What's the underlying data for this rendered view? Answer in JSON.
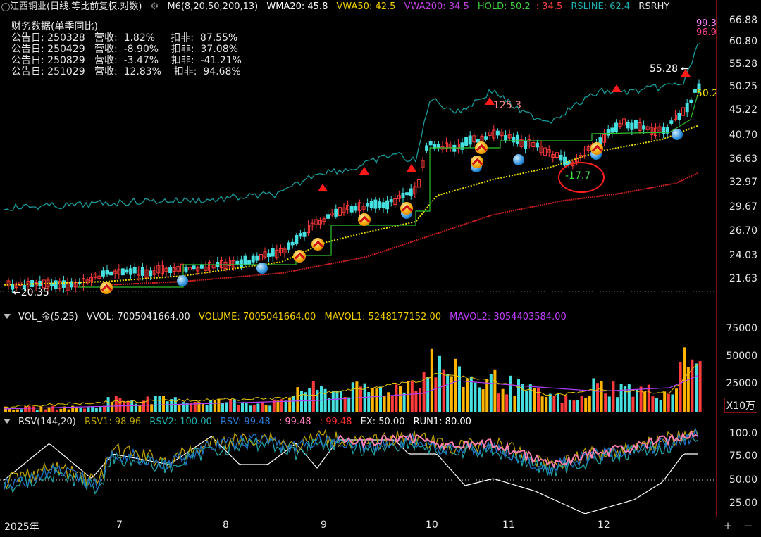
{
  "main_header": {
    "symbol": "江西铜业(日线.等比前复权.对数)",
    "m6": "M6(8,20,50,200,13)",
    "wma20": "WMA20: 45.8",
    "vwa50": "VWA50: 42.5",
    "vwa200": "VWA200: 34.5",
    "hold_label": "HOLD: 50.2",
    "hold_sep": ":",
    "hold_val2": "34.5",
    "rsline": "RSLINE: 62.4",
    "rsrhy": "RSRHY"
  },
  "financials": {
    "title": "财务数据(单季同比)",
    "rows": [
      "公告日: 250328   营收:  1.82%     扣非:  87.55%",
      "公告日: 250429   营收:  -8.90%    扣非:  37.08%",
      "公告日: 250829   营收:  -3.47%    扣非:  -41.21%",
      "公告日: 251029   营收:  12.83%    扣非:  94.68%"
    ]
  },
  "price_annotations": {
    "low": "20.35",
    "high": "55.28",
    "high_arrow": "←",
    "low_arrow": "←",
    "label_125": "125.3",
    "label_neg": "-17.7",
    "hold_right": "50.2",
    "rs_right_1": "99.3",
    "rs_right_2": "96.9"
  },
  "price_axis": [
    "66.88",
    "60.80",
    "55.28",
    "50.25",
    "45.22",
    "40.70",
    "36.63",
    "32.97",
    "29.67",
    "26.70",
    "24.03",
    "21.63"
  ],
  "volume_header": {
    "name": "VOL_金(5,25)",
    "vvol": "VVOL: 7005041664.00",
    "volume": "VOLUME: 7005041664.00",
    "mavol1": "MAVOL1: 5248177152.00",
    "mavol2": "MAVOL2: 3054403584.00"
  },
  "volume_axis": [
    "75000",
    "50000",
    "25000"
  ],
  "volume_unit": "X10万",
  "rsv_header": {
    "name": "RSV(144,20)",
    "rsv1": "RSV1: 98.96",
    "rsv2": "RSV2: 100.00",
    "rsv": "RSV: 99.48",
    "v1": ": 99.48",
    "v2": ": 99.48",
    "ex": "EX: 50.00",
    "run1": "RUN1: 80.00"
  },
  "rsv_axis": [
    "100.0",
    "75.00",
    "50.00",
    "25.00"
  ],
  "months": [
    "2025年",
    "7",
    "8",
    "9",
    "10",
    "11",
    "12"
  ],
  "controls": {
    "plus": "+",
    "minus": "−"
  },
  "colors": {
    "up": "#ff3b3b",
    "down": "#46e0e0",
    "wma": "#f0e000",
    "vwa200": "#d02020",
    "vwa200b": "#b030d0",
    "hold": "#30c030",
    "rsline": "#1a9a9a",
    "vol_gold": "#ffb400",
    "mavol1": "#e8c800",
    "mavol2": "#b040ff",
    "rsv1": "#b8a000",
    "rsv2": "#20a0a0",
    "rsv": "#2070c0",
    "run1": "#ffffff",
    "pink": "#ff80b0"
  }
}
